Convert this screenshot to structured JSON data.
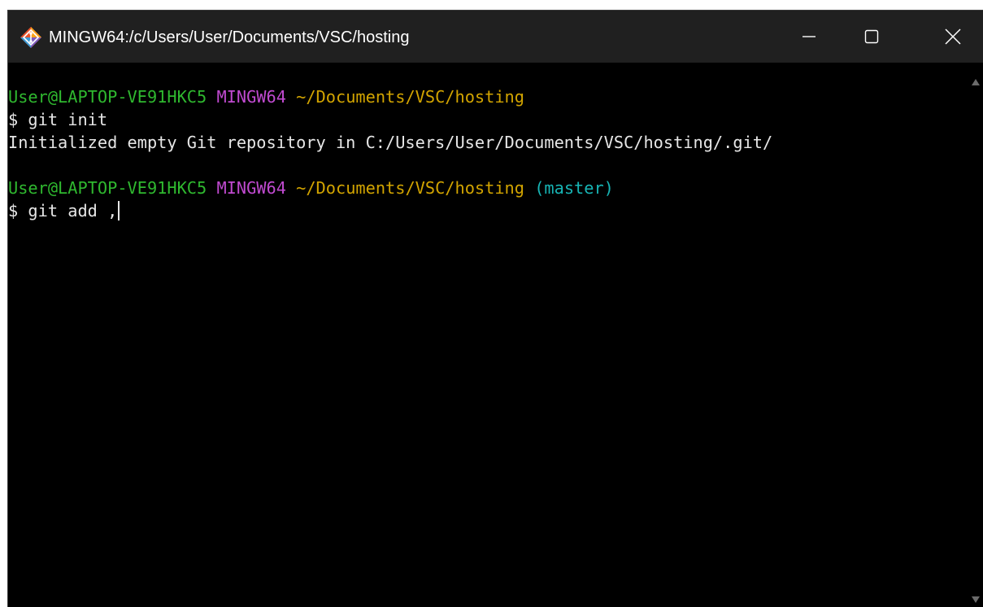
{
  "background_text": "                                                     ",
  "window": {
    "title": "MINGW64:/c/Users/User/Documents/VSC/hosting",
    "app_icon": "git-bash-icon",
    "controls": {
      "minimize": "minimize-icon",
      "maximize": "maximize-icon",
      "close": "close-icon"
    }
  },
  "colors": {
    "terminal_bg": "#000000",
    "titlebar_bg": "#202020",
    "user": "#2fb82f",
    "host": "#c04ad0",
    "path": "#d2a400",
    "branch": "#17b5b5",
    "text": "#e6e6e6"
  },
  "terminal": {
    "prompt1": {
      "user": "User@LAPTOP-VE91HKC5",
      "host": "MINGW64",
      "path": "~/Documents/VSC/hosting"
    },
    "command1": "$ git init",
    "output1": "Initialized empty Git repository in C:/Users/User/Documents/VSC/hosting/.git/",
    "prompt2": {
      "user": "User@LAPTOP-VE91HKC5",
      "host": "MINGW64",
      "path": "~/Documents/VSC/hosting",
      "branch": "(master)"
    },
    "command2": "$ git add ,"
  }
}
